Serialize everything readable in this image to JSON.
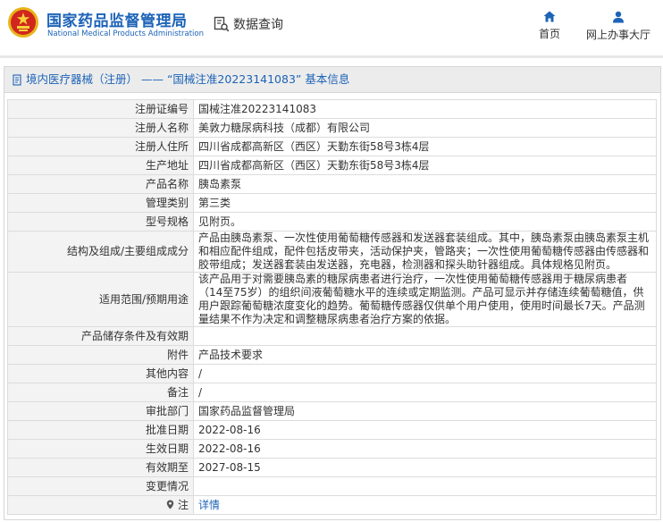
{
  "header": {
    "brand_cn": "国家药品监督管理局",
    "brand_en": "National Medical Products Administration",
    "search_label": "数据查询",
    "nav_home": "首页",
    "nav_online": "网上办事大厅",
    "brand_color": "#1d63b7"
  },
  "breadcrumb": "境内医疗器械（注册） —— “国械注准20223141083” 基本信息",
  "rows": [
    {
      "label": "注册证编号",
      "value": "国械注准20223141083"
    },
    {
      "label": "注册人名称",
      "value": "美敦力糖尿病科技（成都）有限公司"
    },
    {
      "label": "注册人住所",
      "value": "四川省成都高新区（西区）天勤东街58号3栋4层"
    },
    {
      "label": "生产地址",
      "value": "四川省成都高新区（西区）天勤东街58号3栋4层"
    },
    {
      "label": "产品名称",
      "value": "胰岛素泵"
    },
    {
      "label": "管理类别",
      "value": "第三类"
    },
    {
      "label": "型号规格",
      "value": "见附页。"
    },
    {
      "label": "结构及组成/主要组成成分",
      "value": "产品由胰岛素泵、一次性使用葡萄糖传感器和发送器套装组成。其中，胰岛素泵由胰岛素泵主机和相应配件组成，配件包括皮带夹，活动保护夹，管路夹；一次性使用葡萄糖传感器由传感器和胶带组成；发送器套装由发送器，充电器，检测器和探头助针器组成。具体规格见附页。"
    },
    {
      "label": "适用范围/预期用途",
      "value": "该产品用于对需要胰岛素的糖尿病患者进行治疗，一次性使用葡萄糖传感器用于糖尿病患者（14至75岁）的组织间液葡萄糖水平的连续或定期监测。产品可显示并存储连续葡萄糖值，供用户跟踪葡萄糖浓度变化的趋势。葡萄糖传感器仅供单个用户使用，使用时间最长7天。产品测量结果不作为决定和调整糖尿病患者治疗方案的依据。"
    },
    {
      "label": "产品储存条件及有效期",
      "value": ""
    },
    {
      "label": "附件",
      "value": "产品技术要求"
    },
    {
      "label": "其他内容",
      "value": "/"
    },
    {
      "label": "备注",
      "value": "/"
    },
    {
      "label": "审批部门",
      "value": "国家药品监督管理局"
    },
    {
      "label": "批准日期",
      "value": "2022-08-16"
    },
    {
      "label": "生效日期",
      "value": "2022-08-16"
    },
    {
      "label": "有效期至",
      "value": "2027-08-15"
    },
    {
      "label": "变更情况",
      "value": ""
    }
  ],
  "note": {
    "label": "注",
    "link": "详情"
  }
}
